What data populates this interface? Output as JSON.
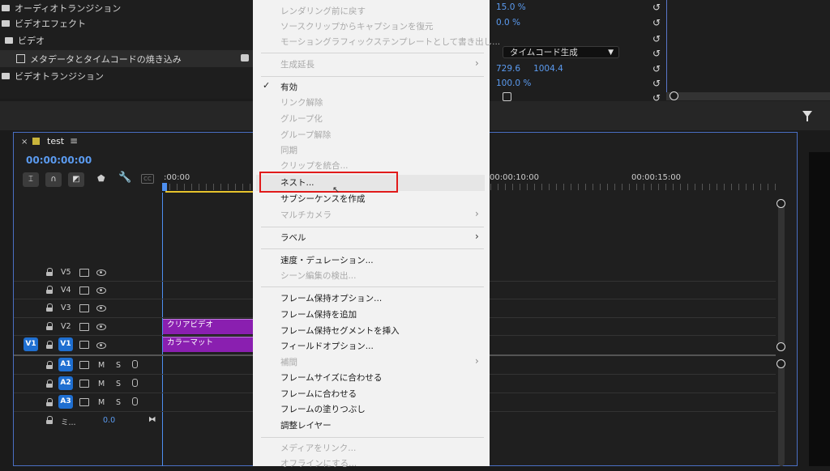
{
  "effects_panel": {
    "items": [
      {
        "label": "オーディオトランジション",
        "icon": "folder-icon"
      },
      {
        "label": "ビデオエフェクト",
        "icon": "folder-icon"
      },
      {
        "label": "ビデオ",
        "icon": "folder-icon"
      },
      {
        "label": "メタデータとタイムコードの焼き込み",
        "icon": "effect-icon"
      },
      {
        "label": "ビデオトランジション",
        "icon": "folder-icon"
      }
    ]
  },
  "effect_controls": {
    "values": [
      "15.0 %",
      "0.0 %",
      "タイムコード生成",
      "729.6",
      "1004.4",
      "100.0 %"
    ]
  },
  "context_menu": {
    "items": [
      {
        "label": "レンダリング前に戻す",
        "enabled": false
      },
      {
        "label": "ソースクリップからキャプションを復元",
        "enabled": false
      },
      {
        "label": "モーショングラフィックステンプレートとして書き出し...",
        "enabled": false
      },
      {
        "label": "生成延長",
        "enabled": false,
        "submenu": true
      },
      {
        "label": "有効",
        "enabled": true,
        "checked": true
      },
      {
        "label": "リンク解除",
        "enabled": false
      },
      {
        "label": "グループ化",
        "enabled": false
      },
      {
        "label": "グループ解除",
        "enabled": false
      },
      {
        "label": "同期",
        "enabled": false
      },
      {
        "label": "クリップを統合...",
        "enabled": false
      },
      {
        "label": "ネスト...",
        "enabled": true,
        "highlighted": true
      },
      {
        "label": "サブシーケンスを作成",
        "enabled": true
      },
      {
        "label": "マルチカメラ",
        "enabled": false,
        "submenu": true
      },
      {
        "label": "ラベル",
        "enabled": true,
        "submenu": true
      },
      {
        "label": "速度・デュレーション...",
        "enabled": true
      },
      {
        "label": "シーン編集の検出...",
        "enabled": false
      },
      {
        "label": "フレーム保持オプション...",
        "enabled": true
      },
      {
        "label": "フレーム保持を追加",
        "enabled": true
      },
      {
        "label": "フレーム保持セグメントを挿入",
        "enabled": true
      },
      {
        "label": "フィールドオプション...",
        "enabled": true
      },
      {
        "label": "補間",
        "enabled": false,
        "submenu": true
      },
      {
        "label": "フレームサイズに合わせる",
        "enabled": true
      },
      {
        "label": "フレームに合わせる",
        "enabled": true
      },
      {
        "label": "フレームの塗りつぶし",
        "enabled": true
      },
      {
        "label": "調整レイヤー",
        "enabled": true
      },
      {
        "label": "メディアをリンク...",
        "enabled": false
      },
      {
        "label": "オフラインにする...",
        "enabled": false
      }
    ]
  },
  "timeline": {
    "sequence_name": "test",
    "timecode": "00:00:00:00",
    "ruler": [
      ":00:00",
      "00:00:10:00",
      "00:00:15:00"
    ],
    "video_tracks": [
      "V5",
      "V4",
      "V3",
      "V2",
      "V1"
    ],
    "source_v1": "V1",
    "audio_tracks": [
      "A1",
      "A2",
      "A3"
    ],
    "audio_btn_m": "M",
    "audio_btn_s": "S",
    "mix_label": "ミ...",
    "mix_value": "0.0",
    "clips": {
      "v2": "クリアビデオ",
      "v1": "カラーマット"
    }
  },
  "colors": {
    "accent": "#1f6fd1",
    "clip": "#8a1fb0",
    "highlight_box": "#e11b1b"
  }
}
